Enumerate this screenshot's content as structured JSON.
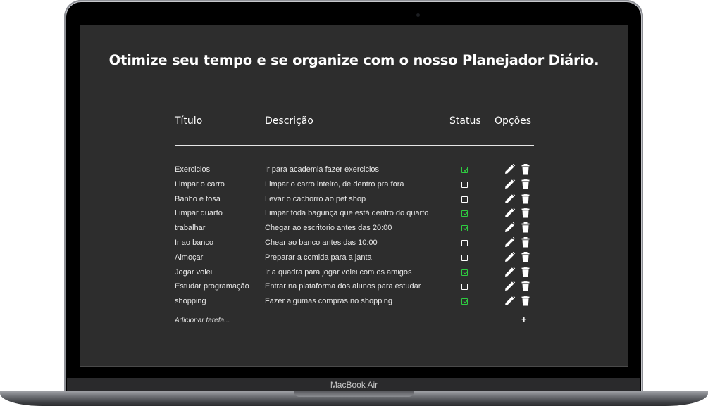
{
  "device": {
    "brand_label": "MacBook Air"
  },
  "planner": {
    "headline": "Otimize seu tempo e se organize com o nosso Planejador Diário.",
    "columns": {
      "title": "Título",
      "description": "Descrição",
      "status": "Status",
      "options": "Opções"
    },
    "tasks": [
      {
        "title": "Exercicios",
        "description": "Ir para academia fazer exercicios",
        "done": true
      },
      {
        "title": "Limpar o carro",
        "description": "Limpar o carro inteiro, de dentro pra fora",
        "done": false
      },
      {
        "title": "Banho e tosa",
        "description": "Levar o cachorro ao pet shop",
        "done": false
      },
      {
        "title": "Limpar quarto",
        "description": "Limpar toda bagunça que está dentro do quarto",
        "done": true
      },
      {
        "title": "trabalhar",
        "description": "Chegar ao escritorio antes das 20:00",
        "done": true
      },
      {
        "title": "Ir ao banco",
        "description": "Chear ao banco antes das 10:00",
        "done": false
      },
      {
        "title": "Almoçar",
        "description": "Preparar a comida para a janta",
        "done": false
      },
      {
        "title": "Jogar volei",
        "description": "Ir a quadra para jogar volei com os amigos",
        "done": true
      },
      {
        "title": "Estudar programação",
        "description": "Entrar na plataforma dos alunos para estudar",
        "done": false
      },
      {
        "title": "shopping",
        "description": "Fazer algumas compras no shopping",
        "done": true
      }
    ],
    "add_task_label": "Adicionar tarefa...",
    "add_button_label": "+",
    "icons": {
      "edit": "pencil-icon",
      "delete": "trash-icon",
      "add": "plus-icon"
    },
    "colors": {
      "screen_background": "#2d2d2d",
      "text": "#ffffff",
      "status_done": "#2ecc40"
    }
  }
}
